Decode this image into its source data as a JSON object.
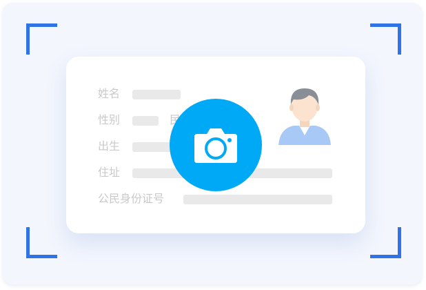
{
  "card": {
    "fields": {
      "name_label": "姓名",
      "gender_label": "性别",
      "ethnicity_partial": "民",
      "birth_label": "出生",
      "address_label": "住址",
      "id_number_label": "公民身份证号"
    }
  },
  "icons": {
    "camera": "camera-icon",
    "avatar": "person-avatar-icon"
  },
  "colors": {
    "accent_blue": "#2f73e7",
    "camera_button": "#00a9f6",
    "placeholder_bar": "#e9e9e9",
    "label_text": "#c9c9c9"
  }
}
